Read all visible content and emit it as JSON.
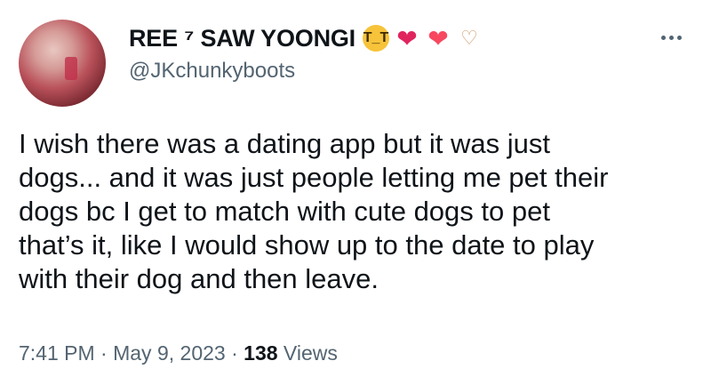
{
  "user": {
    "display_name": "REE ⁷ SAW YOONGI",
    "handle": "@JKchunkyboots",
    "emojis": [
      "loudly-crying-face",
      "two-hearts",
      "heart-with-ribbon",
      "heart-hands"
    ]
  },
  "tweet": {
    "text": "I wish there was a dating app but it was just\ndogs... and it was just people letting me pet their\ndogs bc I get to match with cute dogs to pet\nthat’s it, like I would show up to the date to play\nwith their dog and then leave."
  },
  "meta": {
    "time": "7:41 PM",
    "separator": "·",
    "date": "May 9, 2023",
    "views_count": "138",
    "views_label": "Views"
  },
  "colors": {
    "text": "#0f1419",
    "secondary": "#536471"
  }
}
